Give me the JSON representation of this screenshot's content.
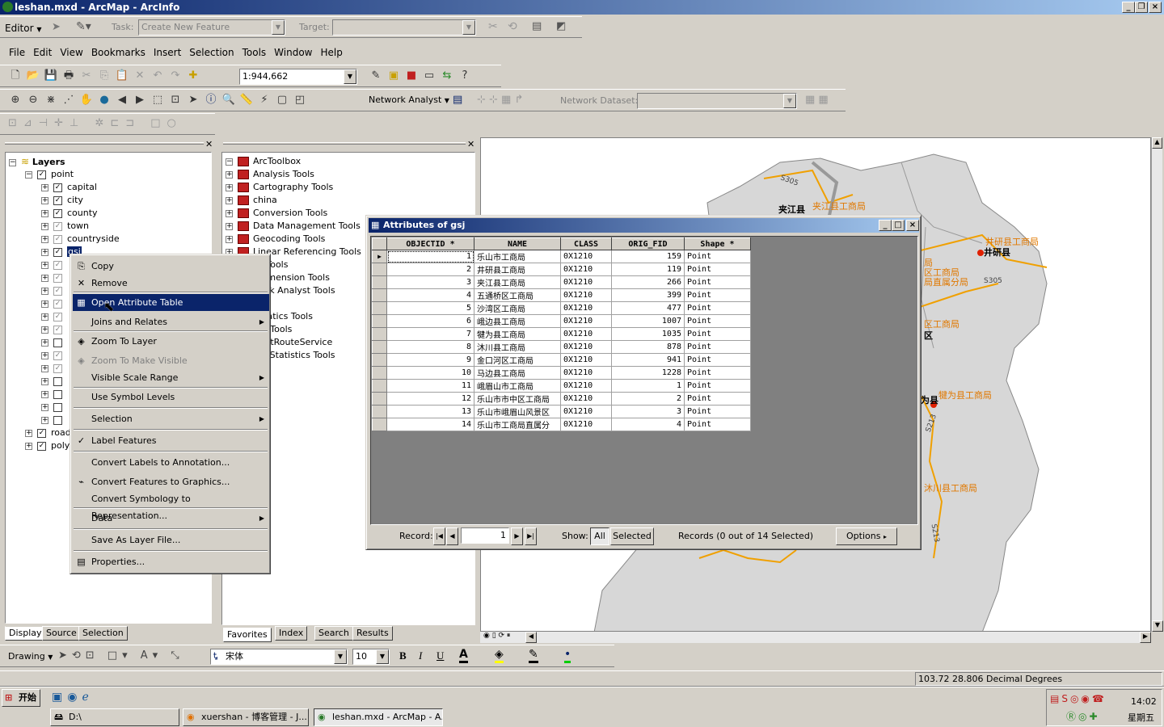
{
  "window": {
    "title": "leshan.mxd - ArcMap - ArcInfo"
  },
  "editor_toolbar": {
    "editor_label": "Editor",
    "task_label": "Task:",
    "task_value": "Create New Feature",
    "target_label": "Target:"
  },
  "menubar": {
    "items": [
      "File",
      "Edit",
      "View",
      "Bookmarks",
      "Insert",
      "Selection",
      "Tools",
      "Window",
      "Help"
    ]
  },
  "standard_toolbar": {
    "scale": "1:944,662"
  },
  "tools_toolbar": {
    "network_analyst": "Network Analyst",
    "network_dataset_label": "Network Dataset:"
  },
  "toc": {
    "root": "Layers",
    "group": "point",
    "layers": [
      {
        "name": "capital",
        "checked": true
      },
      {
        "name": "city",
        "checked": true
      },
      {
        "name": "county",
        "checked": true
      },
      {
        "name": "town",
        "checked": false
      },
      {
        "name": "countryside",
        "checked": false
      },
      {
        "name": "gsj",
        "checked": true
      }
    ],
    "other_groups": [
      "road",
      "poly"
    ],
    "tabs": [
      "Display",
      "Source",
      "Selection"
    ]
  },
  "context_menu": {
    "items": [
      "Copy",
      "Remove",
      "Open Attribute Table",
      "Joins and Relates",
      "Zoom To Layer",
      "Zoom To Make Visible",
      "Visible Scale Range",
      "Use Symbol Levels",
      "Selection",
      "Label Features",
      "Convert Labels to Annotation...",
      "Convert Features to Graphics...",
      "Convert Symbology to Representation...",
      "Data",
      "Save As Layer File...",
      "Properties..."
    ]
  },
  "toolbox": {
    "root": "ArcToolbox",
    "items": [
      "Analysis Tools",
      "Cartography Tools",
      "china",
      "Conversion Tools",
      "Data Management Tools",
      "Geocoding Tools",
      "Linear Referencing Tools",
      "ile Tools",
      "tidimension Tools",
      "work Analyst Tools",
      "ples",
      "ematics Tools",
      "ver Tools",
      "rtestRouteService",
      "tial Statistics Tools"
    ],
    "tabs": [
      "Favorites",
      "Index",
      "Search",
      "Results"
    ]
  },
  "attributes": {
    "title": "Attributes of gsj",
    "columns": [
      "OBJECTID *",
      "NAME",
      "CLASS",
      "ORIG_FID",
      "Shape *"
    ],
    "rows": [
      [
        "1",
        "乐山市工商局",
        "0X1210",
        "159",
        "Point"
      ],
      [
        "2",
        "井研县工商局",
        "0X1210",
        "119",
        "Point"
      ],
      [
        "3",
        "夹江县工商局",
        "0X1210",
        "266",
        "Point"
      ],
      [
        "4",
        "五通桥区工商局",
        "0X1210",
        "399",
        "Point"
      ],
      [
        "5",
        "沙湾区工商局",
        "0X1210",
        "477",
        "Point"
      ],
      [
        "6",
        "峨边县工商局",
        "0X1210",
        "1007",
        "Point"
      ],
      [
        "7",
        "犍为县工商局",
        "0X1210",
        "1035",
        "Point"
      ],
      [
        "8",
        "沐川县工商局",
        "0X1210",
        "878",
        "Point"
      ],
      [
        "9",
        "金口河区工商局",
        "0X1210",
        "941",
        "Point"
      ],
      [
        "10",
        "马边县工商局",
        "0X1210",
        "1228",
        "Point"
      ],
      [
        "11",
        "峨眉山市工商局",
        "0X1210",
        "1",
        "Point"
      ],
      [
        "12",
        "乐山市市中区工商局",
        "0X1210",
        "2",
        "Point"
      ],
      [
        "13",
        "乐山市峨眉山风景区",
        "0X1210",
        "3",
        "Point"
      ],
      [
        "14",
        "乐山市工商局直属分",
        "0X1210",
        "4",
        "Point"
      ]
    ],
    "record_label": "Record:",
    "record_value": "1",
    "show_label": "Show:",
    "all_btn": "All",
    "selected_btn": "Selected",
    "records_text": "Records (0 out of 14 Selected)",
    "options_btn": "Options"
  },
  "map": {
    "labels_orange": [
      "夹江县工商局",
      "井研县工商局",
      "局",
      "区工商局",
      "局直属分局",
      "区工商局",
      "犍为县工商局",
      "沐川县工商局"
    ],
    "labels_black": [
      "夹江县",
      "井研县",
      "区",
      "为县"
    ],
    "roads": [
      "S305",
      "S305",
      "S213",
      "S213"
    ]
  },
  "drawing_toolbar": {
    "drawing_label": "Drawing",
    "font": "宋体",
    "size": "10"
  },
  "status": {
    "coords": "103.72  28.806 Decimal Degrees"
  },
  "taskbar": {
    "start": "开始",
    "tasks": [
      "D:\\",
      "xuershan - 博客管理 - J...",
      "leshan.mxd - ArcMap - A..."
    ],
    "time": "14:02",
    "day": "星期五"
  }
}
